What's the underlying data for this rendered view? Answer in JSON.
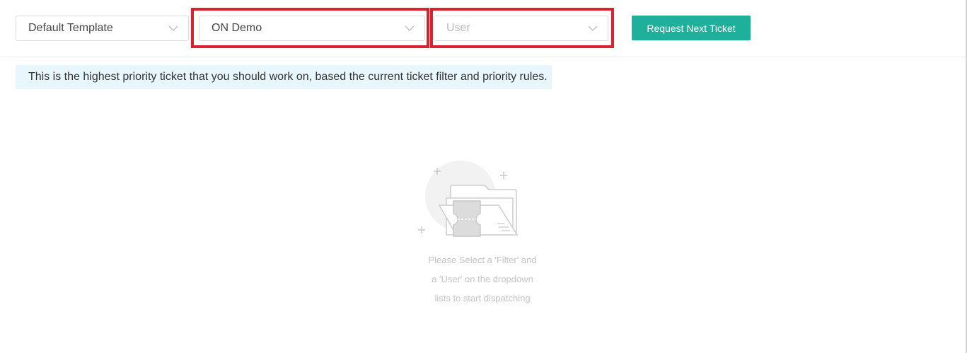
{
  "toolbar": {
    "template_select": {
      "value": "Default Template"
    },
    "filter_select": {
      "value": "ON Demo"
    },
    "user_select": {
      "placeholder": "User"
    },
    "request_button_label": "Request Next Ticket"
  },
  "info_banner": {
    "text": "This is the highest priority ticket that you should work on, based the current ticket filter and priority rules."
  },
  "empty_state": {
    "icon": "empty-folder-ticket-icon",
    "lines": [
      "Please Select a 'Filter' and",
      "a 'User' on the dropdown",
      "lists to start dispatching"
    ]
  },
  "colors": {
    "accent": "#1fb09b",
    "highlight": "#d7232f",
    "banner_bg": "#e8f6fd"
  }
}
